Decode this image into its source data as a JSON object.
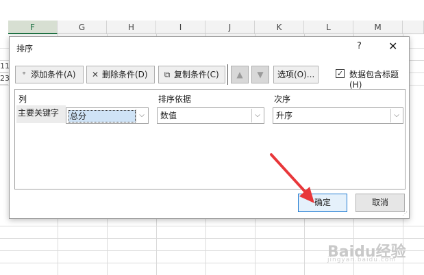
{
  "sheet": {
    "columns": [
      "F",
      "G",
      "H",
      "I",
      "J",
      "K",
      "L",
      "M"
    ],
    "left_cells": [
      "11",
      "23"
    ]
  },
  "dialog": {
    "title": "排序",
    "help_label": "?",
    "close_label": "✕",
    "toolbar": {
      "add_level": "添加条件(A)",
      "delete_level": "删除条件(D)",
      "copy_level": "复制条件(C)",
      "move_up": "▲",
      "move_down": "▼",
      "options": "选项(O)...",
      "has_headers_label": "数据包含标题(H)",
      "has_headers_checked": "✓"
    },
    "headers": {
      "column": "列",
      "sort_on": "排序依据",
      "order": "次序"
    },
    "rows": [
      {
        "label": "主要关键字",
        "column_value": "总分",
        "sort_on_value": "数值",
        "order_value": "升序"
      }
    ],
    "ok_label": "确定",
    "cancel_label": "取消"
  },
  "watermark": {
    "text": "Baidu经验",
    "sub": "jingyan.baidu.com"
  },
  "colors": {
    "annotation_arrow": "#e8373a",
    "primary_border": "#1f7ad1",
    "selected_column": "#217346"
  }
}
